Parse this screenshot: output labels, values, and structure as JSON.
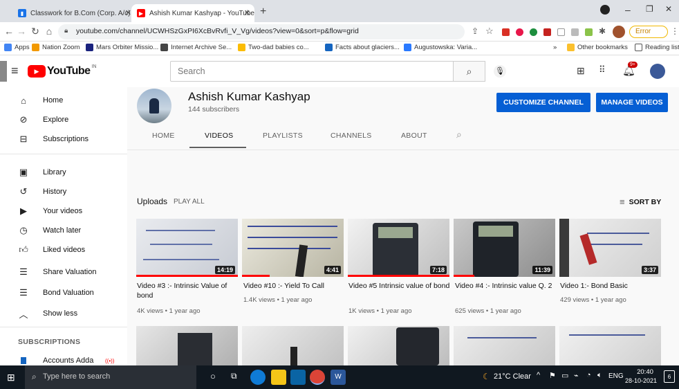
{
  "browser": {
    "tabs": [
      {
        "title": "Classwork for B.Com (Corp. A/c)"
      },
      {
        "title": "Ashish Kumar Kashyap - YouTube"
      }
    ],
    "url": "youtube.com/channel/UCWHSzGxPI6XcBvRvfi_V_Vg/videos?view=0&sort=p&flow=grid",
    "error_label": "Error",
    "bookmarks": [
      "Apps",
      "Nation Zoom",
      "Mars Orbiter Missio...",
      "Internet Archive Se...",
      "Two-dad babies co...",
      "Facts about glaciers...",
      "Augustowska: Varia..."
    ],
    "other_bookmarks": "Other bookmarks",
    "reading_list": "Reading list"
  },
  "youtube": {
    "logo": "YouTube",
    "region": "IN",
    "search_placeholder": "Search",
    "notification_count": "9+"
  },
  "sidebar": {
    "items": [
      {
        "label": "Home",
        "icon": "home-icon"
      },
      {
        "label": "Explore",
        "icon": "compass-icon"
      },
      {
        "label": "Subscriptions",
        "icon": "subscriptions-icon"
      },
      {
        "label": "Library",
        "icon": "library-icon"
      },
      {
        "label": "History",
        "icon": "history-icon"
      },
      {
        "label": "Your videos",
        "icon": "play-icon"
      },
      {
        "label": "Watch later",
        "icon": "clock-icon"
      },
      {
        "label": "Liked videos",
        "icon": "thumb-up-icon"
      },
      {
        "label": "Share Valuation",
        "icon": "playlist-icon"
      },
      {
        "label": "Bond Valuation",
        "icon": "playlist-icon"
      },
      {
        "label": "Show less",
        "icon": "chevron-up-icon"
      }
    ],
    "subscriptions_heading": "SUBSCRIPTIONS",
    "subscription": "Accounts Adda"
  },
  "channel": {
    "name": "Ashish Kumar Kashyap",
    "subscribers": "144 subscribers",
    "customize": "CUSTOMIZE CHANNEL",
    "manage": "MANAGE VIDEOS",
    "tabs": [
      "HOME",
      "VIDEOS",
      "PLAYLISTS",
      "CHANNELS",
      "ABOUT"
    ],
    "active_tab": "VIDEOS"
  },
  "uploads": {
    "heading": "Uploads",
    "play_all": "PLAY ALL",
    "sort_by": "SORT BY",
    "videos": [
      {
        "title": "Video #3 :- Intrinsic Value of bond",
        "meta": "4K views • 1 year ago",
        "duration": "14:19"
      },
      {
        "title": "Video #10 :- Yield To Call",
        "meta": "1.4K views • 1 year ago",
        "duration": "4:41"
      },
      {
        "title": "Video #5 Intrinsic value of bond",
        "meta": "1K views • 1 year ago",
        "duration": "7:18"
      },
      {
        "title": "Video #4 :- Intrinsic value Q. 2",
        "meta": "625 views • 1 year ago",
        "duration": "11:39"
      },
      {
        "title": "Video 1:- Bond Basic",
        "meta": "429 views • 1 year ago",
        "duration": "3:37"
      }
    ]
  },
  "taskbar": {
    "search_placeholder": "Type here to search",
    "weather": "21°C Clear",
    "language": "ENG",
    "time": "20:40",
    "date": "28-10-2021",
    "notifications": "6"
  },
  "colors": {
    "accent": "#065fd4",
    "youtube_red": "#ff0000"
  }
}
